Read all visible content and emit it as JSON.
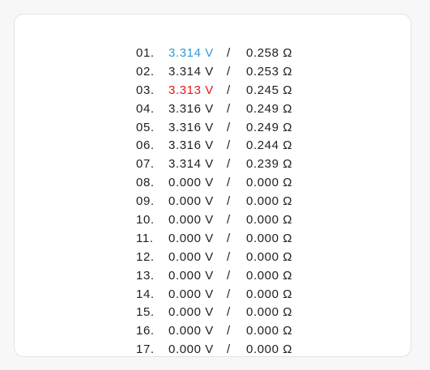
{
  "colors": {
    "max_voltage": "#2f9ad8",
    "min_voltage": "#e81515",
    "text": "#212121"
  },
  "separator": "/",
  "cells": [
    {
      "index": "01.",
      "voltage": "3.314 V",
      "resistance": "0.258 Ω",
      "highlight": "max"
    },
    {
      "index": "02.",
      "voltage": "3.314 V",
      "resistance": "0.253 Ω",
      "highlight": ""
    },
    {
      "index": "03.",
      "voltage": "3.313 V",
      "resistance": "0.245 Ω",
      "highlight": "min"
    },
    {
      "index": "04.",
      "voltage": "3.316 V",
      "resistance": "0.249 Ω",
      "highlight": ""
    },
    {
      "index": "05.",
      "voltage": "3.316 V",
      "resistance": "0.249 Ω",
      "highlight": ""
    },
    {
      "index": "06.",
      "voltage": "3.316 V",
      "resistance": "0.244 Ω",
      "highlight": ""
    },
    {
      "index": "07.",
      "voltage": "3.314 V",
      "resistance": "0.239 Ω",
      "highlight": ""
    },
    {
      "index": "08.",
      "voltage": "0.000 V",
      "resistance": "0.000 Ω",
      "highlight": ""
    },
    {
      "index": "09.",
      "voltage": "0.000 V",
      "resistance": "0.000 Ω",
      "highlight": ""
    },
    {
      "index": "10.",
      "voltage": "0.000 V",
      "resistance": "0.000 Ω",
      "highlight": ""
    },
    {
      "index": "11.",
      "voltage": "0.000 V",
      "resistance": "0.000 Ω",
      "highlight": ""
    },
    {
      "index": "12.",
      "voltage": "0.000 V",
      "resistance": "0.000 Ω",
      "highlight": ""
    },
    {
      "index": "13.",
      "voltage": "0.000 V",
      "resistance": "0.000 Ω",
      "highlight": ""
    },
    {
      "index": "14.",
      "voltage": "0.000 V",
      "resistance": "0.000 Ω",
      "highlight": ""
    },
    {
      "index": "15.",
      "voltage": "0.000 V",
      "resistance": "0.000 Ω",
      "highlight": ""
    },
    {
      "index": "16.",
      "voltage": "0.000 V",
      "resistance": "0.000 Ω",
      "highlight": ""
    },
    {
      "index": "17.",
      "voltage": "0.000 V",
      "resistance": "0.000 Ω",
      "highlight": ""
    }
  ]
}
